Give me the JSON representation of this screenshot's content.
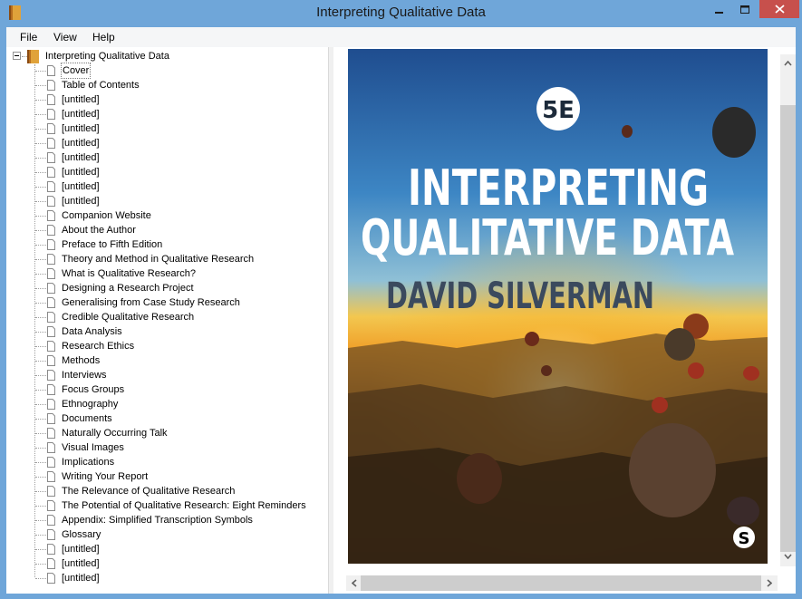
{
  "window": {
    "title": "Interpreting Qualitative Data"
  },
  "menu": [
    "File",
    "View",
    "Help"
  ],
  "tree": {
    "root": "Interpreting Qualitative Data",
    "items": [
      "Cover",
      "Table of                    Contents",
      "[untitled]",
      "[untitled]",
      "[untitled]",
      "[untitled]",
      "[untitled]",
      "[untitled]",
      "[untitled]",
      "[untitled]",
      "Companion Website",
      "About the Author",
      "Preface to Fifth Edition",
      "Theory and Method in Qualitative Research",
      "What is Qualitative Research?",
      "Designing a Research Project",
      "Generalising from Case Study Research",
      "Credible Qualitative Research",
      "Data Analysis",
      "Research Ethics",
      "Methods",
      "Interviews",
      "Focus Groups",
      "Ethnography",
      "Documents",
      "Naturally Occurring Talk",
      "Visual Images",
      "Implications",
      "Writing Your Report",
      "The Relevance of Qualitative Research",
      "The Potential of Qualitative Research: Eight Reminders",
      "Appendix: Simplified Transcription Symbols",
      "Glossary",
      "[untitled]",
      "[untitled]",
      "[untitled]"
    ],
    "selected_index": 0
  },
  "cover": {
    "edition": "5E",
    "title_line1": "INTERPRETING",
    "title_line2": "QUALITATIVE DATA",
    "author": "DAVID SILVERMAN",
    "publisher_mark": "S"
  },
  "colors": {
    "window_frame": "#6fa6d9",
    "close_button": "#c7504c",
    "author_text": "#3b4a5e",
    "sky_top": "#1f4d8f",
    "sunset": "#f0a22c"
  },
  "icons": {
    "app": "book-icon",
    "tree_item": "page-icon",
    "minimize": "minimize-icon",
    "maximize": "maximize-icon",
    "close": "close-icon"
  }
}
